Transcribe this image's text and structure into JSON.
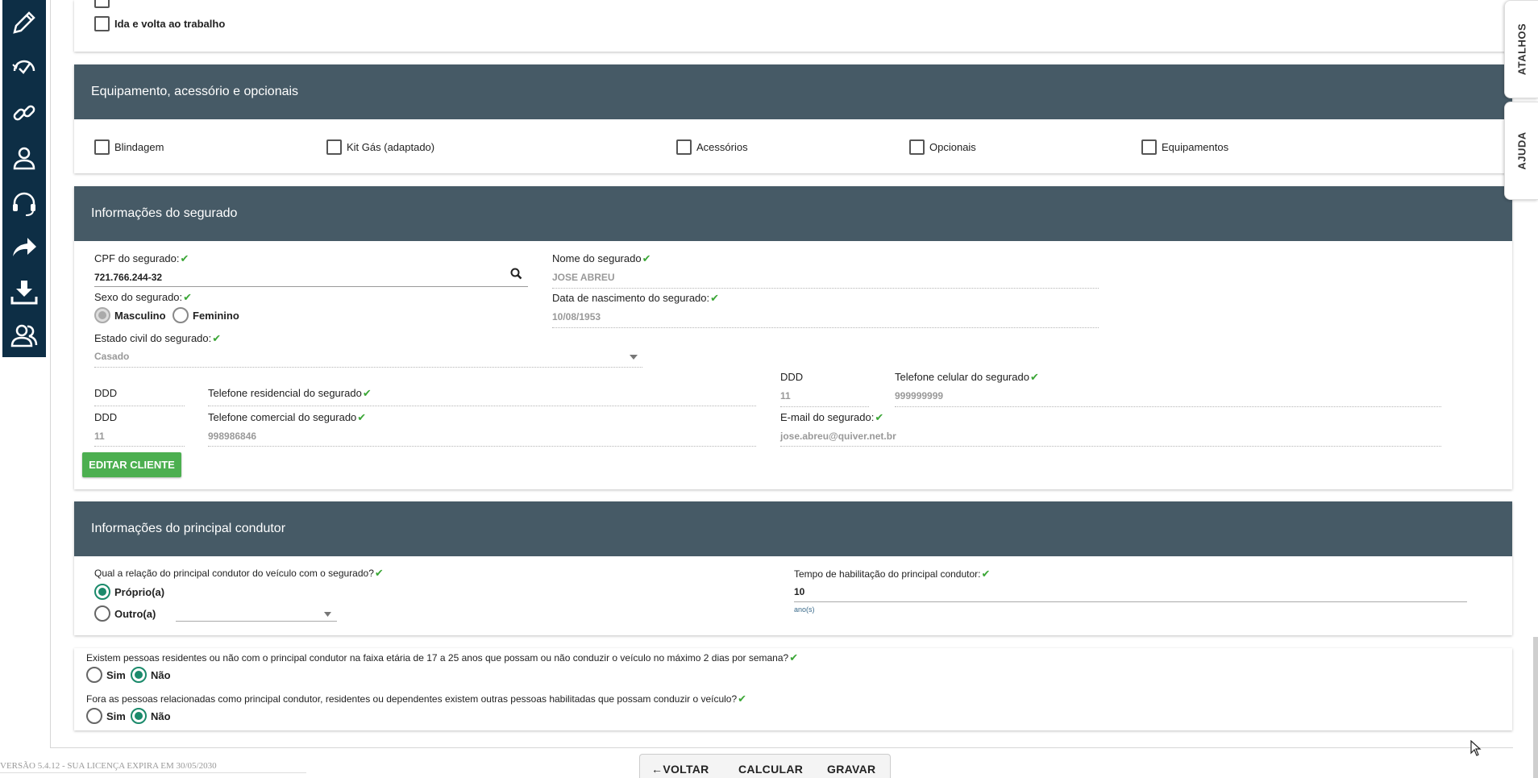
{
  "sidebar": {
    "icons": [
      "pencil-icon",
      "speedometer-icon",
      "link-icon",
      "user-icon",
      "headset-icon",
      "share-arrow-icon",
      "download-tray-icon",
      "users-icon"
    ]
  },
  "top_section": {
    "partial_checkbox_label": "Ida e volta ao trabalho"
  },
  "equipment": {
    "title": "Equipamento, acessório e opcionais",
    "options": [
      "Blindagem",
      "Kit Gás (adaptado)",
      "Acessórios",
      "Opcionais",
      "Equipamentos"
    ]
  },
  "insured": {
    "title": "Informações do segurado",
    "cpf_label": "CPF do segurado:",
    "cpf_value": "721.766.244-32",
    "name_label": "Nome do segurado",
    "name_value": "JOSE ABREU",
    "sex_label": "Sexo do segurado:",
    "sex_male": "Masculino",
    "sex_female": "Feminino",
    "birth_label": "Data de nascimento do segurado:",
    "birth_value": "10/08/1953",
    "civil_label": "Estado civil do segurado:",
    "civil_value": "Casado",
    "ddd_label": "DDD",
    "home_phone_label": "Telefone residencial do segurado",
    "cell_ddd_value": "11",
    "cell_phone_label": "Telefone celular do segurado",
    "cell_phone_value": "999999999",
    "work_ddd_value": "11",
    "work_phone_label": "Telefone comercial do segurado",
    "work_phone_value": "998986846",
    "email_label": "E-mail do segurado:",
    "email_value": "jose.abreu@quiver.net.br",
    "edit_button": "EDITAR CLIENTE"
  },
  "driver": {
    "title": "Informações do principal condutor",
    "relation_label": "Qual a relação do principal condutor do veículo com o segurado?",
    "own": "Próprio(a)",
    "other": "Outro(a)",
    "license_label": "Tempo de habilitação do principal condutor:",
    "license_value": "10",
    "license_unit": "ano(s)"
  },
  "questions": {
    "q1": "Existem pessoas residentes ou não com o principal condutor na faixa etária de 17 a 25 anos que possam ou não conduzir o veículo no máximo 2 dias por semana?",
    "q2": "Fora as pessoas relacionadas como principal condutor, residentes ou dependentes existem outras pessoas habilitadas que possam conduzir o veículo?",
    "yes": "Sim",
    "no": "Não"
  },
  "side_tabs": {
    "shortcuts": "ATALHOS",
    "help": "AJUDA"
  },
  "footer": {
    "back": "VOLTAR",
    "calculate": "CALCULAR",
    "save": "GRAVAR",
    "version": "VERSÃO 5.4.12 - SUA LICENÇA EXPIRA EM 30/05/2030"
  }
}
